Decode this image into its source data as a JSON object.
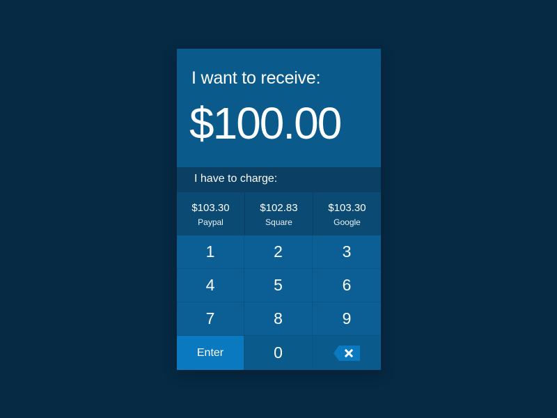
{
  "receive": {
    "label": "I want to receive:",
    "amount": "$100.00"
  },
  "charge": {
    "label": "I have to charge:",
    "providers": [
      {
        "amount": "$103.30",
        "name": "Paypal"
      },
      {
        "amount": "$102.83",
        "name": "Square"
      },
      {
        "amount": "$103.30",
        "name": "Google"
      }
    ]
  },
  "keypad": {
    "keys": [
      "1",
      "2",
      "3",
      "4",
      "5",
      "6",
      "7",
      "8",
      "9"
    ],
    "enter_label": "Enter",
    "zero_label": "0",
    "backspace_icon": "backspace-icon"
  },
  "colors": {
    "background": "#062a44",
    "card": "#0a5a8c",
    "header": "#0b3f63",
    "enter": "#0b79bf"
  }
}
